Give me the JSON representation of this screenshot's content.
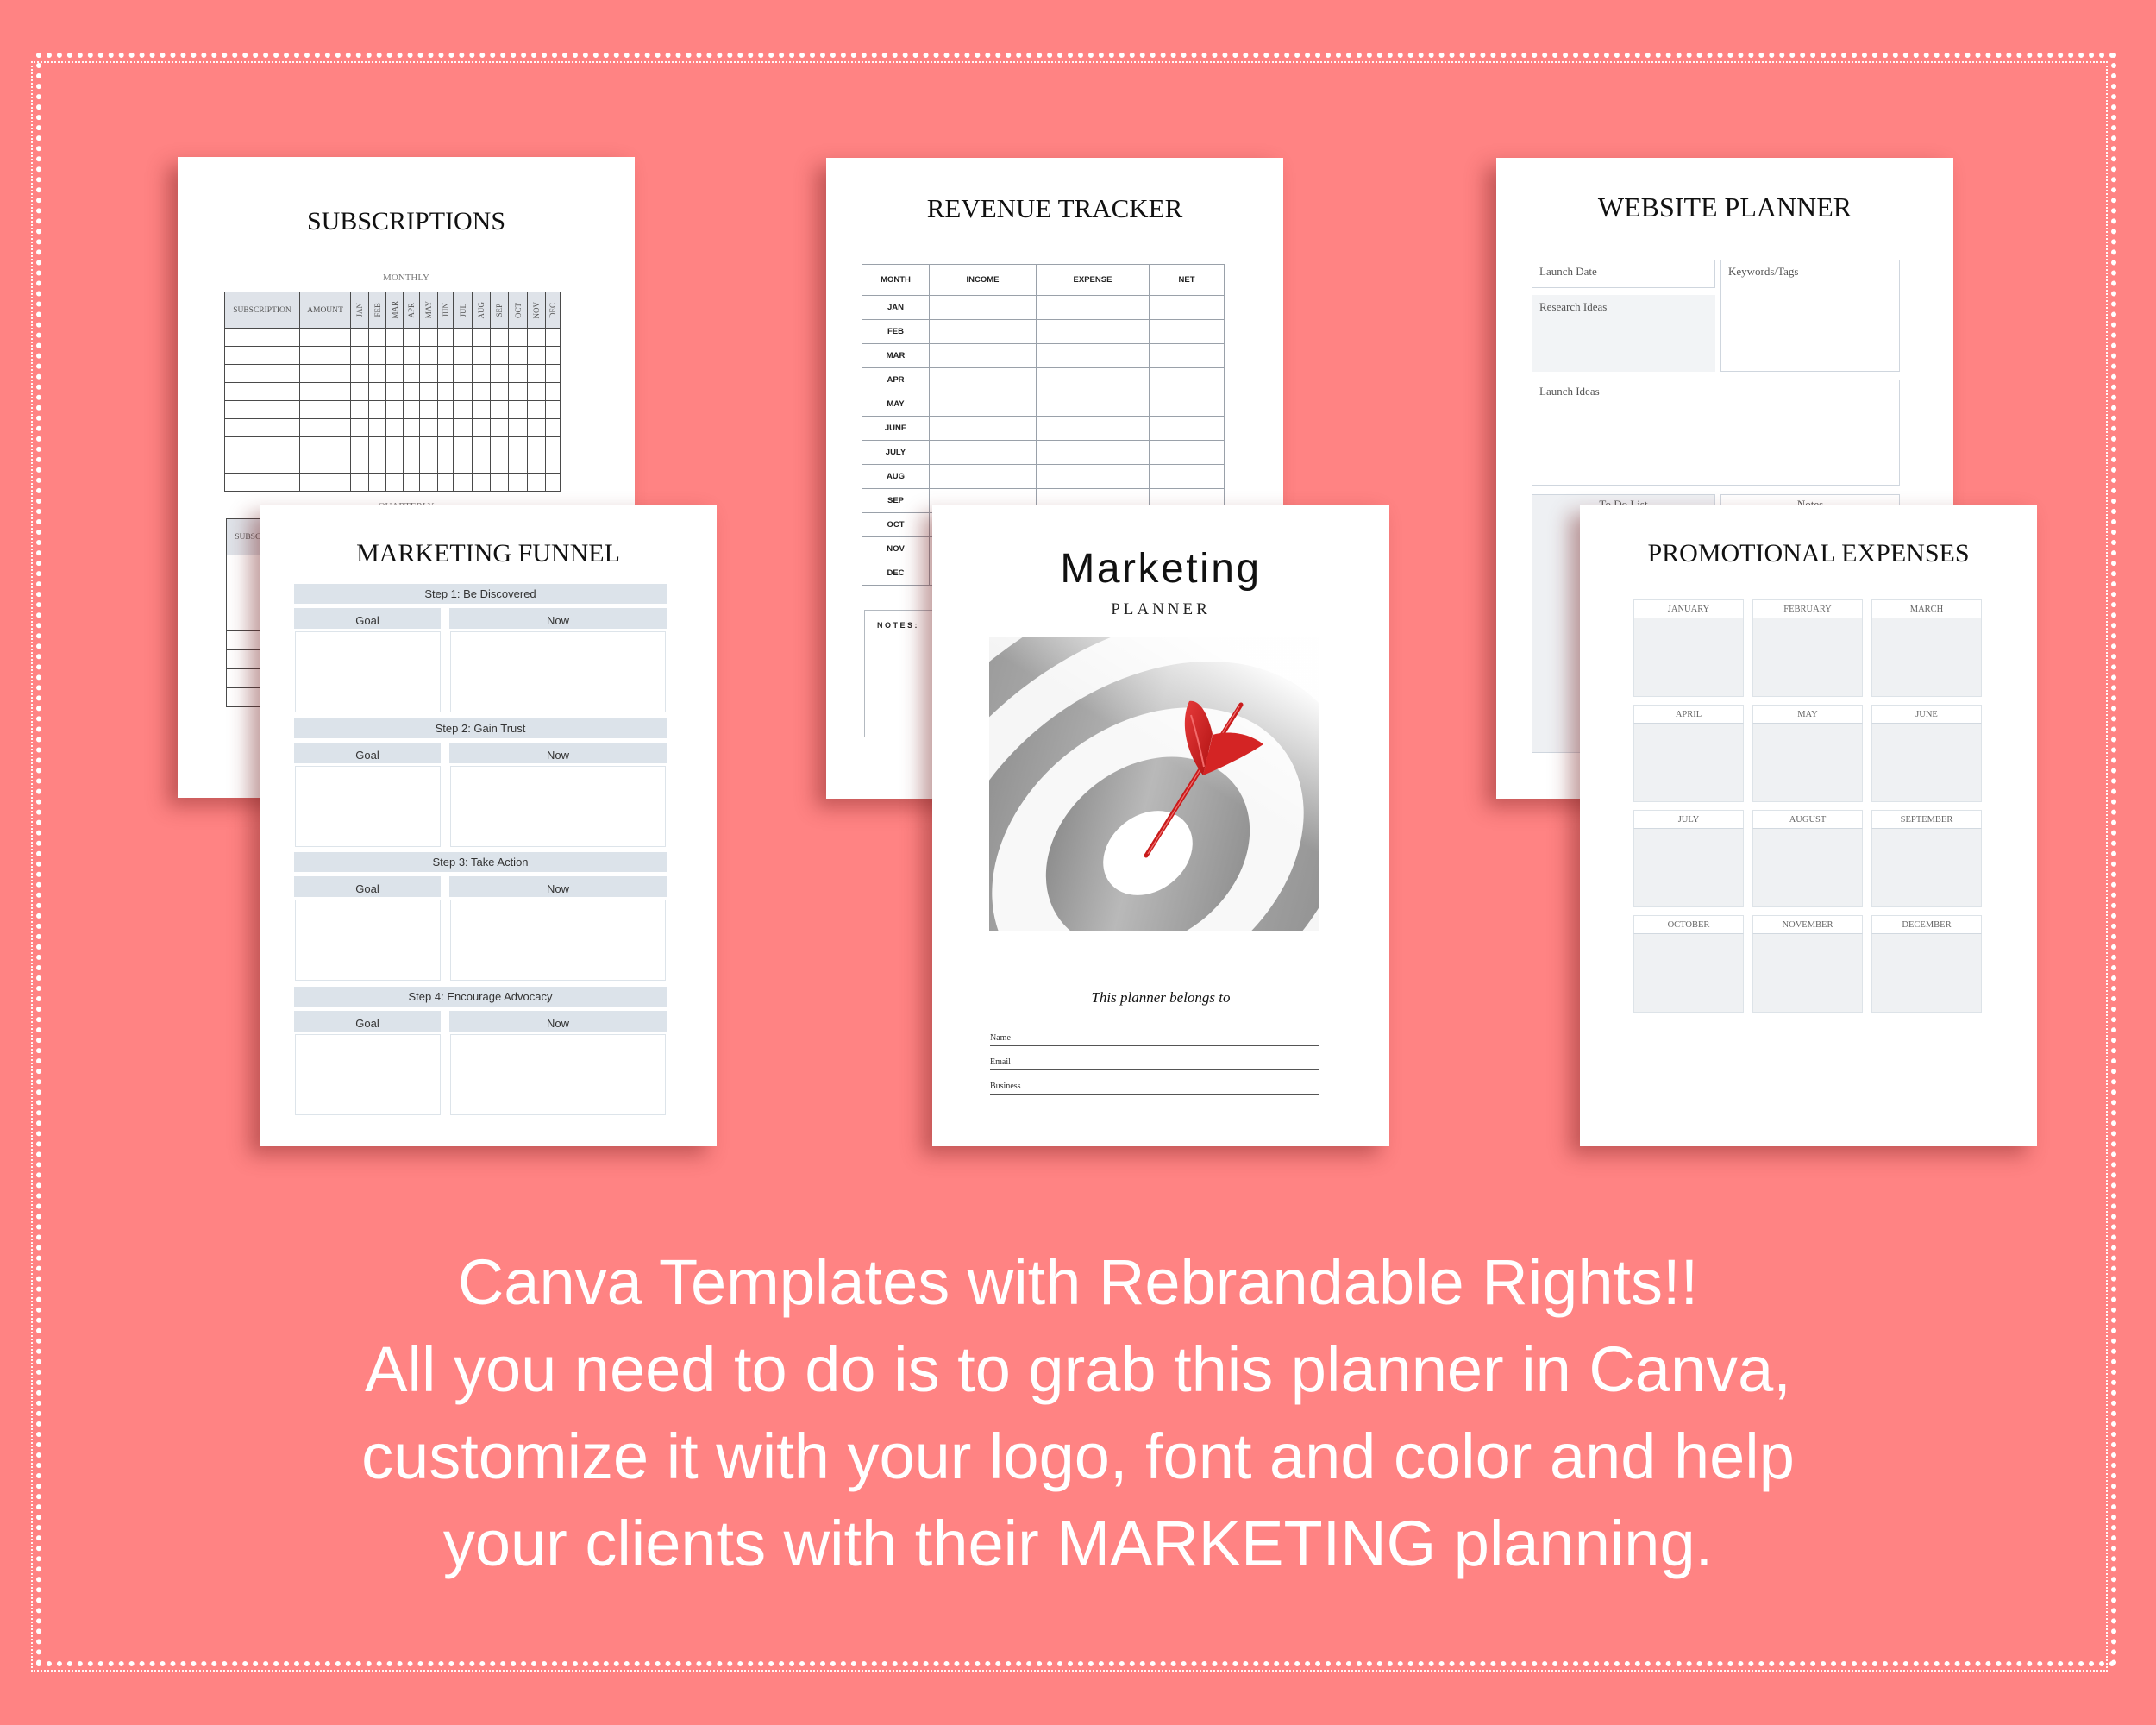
{
  "background_color": "#FF8383",
  "pages": {
    "subscriptions": {
      "title": "SUBSCRIPTIONS",
      "monthly_label": "MONTHLY",
      "monthly_columns": [
        "SUBSCRIPTION",
        "AMOUNT",
        "JAN",
        "FEB",
        "MAR",
        "APR",
        "MAY",
        "JUN",
        "JUL",
        "AUG",
        "SEP",
        "OCT",
        "NOV",
        "DEC"
      ],
      "monthly_rows": 9,
      "quarterly_label": "QUARTERLY",
      "quarterly_columns": [
        "SUBSCRIPTION"
      ],
      "quarterly_rows": 8
    },
    "revenue": {
      "title": "REVENUE TRACKER",
      "columns": [
        "MONTH",
        "INCOME",
        "EXPENSE",
        "NET"
      ],
      "months": [
        "JAN",
        "FEB",
        "MAR",
        "APR",
        "MAY",
        "JUNE",
        "JULY",
        "AUG",
        "SEP",
        "OCT",
        "NOV",
        "DEC"
      ],
      "notes_label": "NOTES:"
    },
    "website": {
      "title": "WEBSITE PLANNER",
      "launch_date": "Launch Date",
      "research_ideas": "Research Ideas",
      "keywords_tags": "Keywords/Tags",
      "launch_ideas": "Launch Ideas",
      "todo_list": "To Do List",
      "notes": "Notes"
    },
    "funnel": {
      "title": "MARKETING FUNNEL",
      "steps": [
        {
          "label": "Step 1: Be Discovered",
          "goal": "Goal",
          "now": "Now"
        },
        {
          "label": "Step 2: Gain Trust",
          "goal": "Goal",
          "now": "Now"
        },
        {
          "label": "Step 3: Take Action",
          "goal": "Goal",
          "now": "Now"
        },
        {
          "label": "Step 4: Encourage Advocacy",
          "goal": "Goal",
          "now": "Now"
        }
      ]
    },
    "cover": {
      "title": "Marketing",
      "subtitle": "PLANNER",
      "image": "target-with-red-dart",
      "belongs_to": "This planner belongs to",
      "fields": [
        "Name",
        "Email",
        "Business"
      ]
    },
    "promo": {
      "title": "PROMOTIONAL EXPENSES",
      "months": [
        "JANUARY",
        "FEBRUARY",
        "MARCH",
        "APRIL",
        "MAY",
        "JUNE",
        "JULY",
        "AUGUST",
        "SEPTEMBER",
        "OCTOBER",
        "NOVEMBER",
        "DECEMBER"
      ]
    }
  },
  "tagline": {
    "lines": [
      "Canva Templates with Rebrandable Rights!!",
      "All you need to do is to grab this planner in Canva,",
      "customize it with your logo, font and color and help",
      "your clients with their MARKETING planning."
    ]
  }
}
